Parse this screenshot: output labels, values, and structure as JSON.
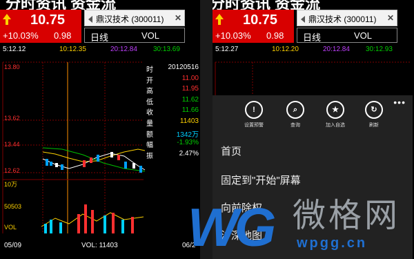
{
  "left": {
    "top_fragment": "分时资讯 资金流",
    "price": "10.75",
    "pct": "+10.03%",
    "chg": "0.98",
    "stock_name": "鼎汉技术 (300011)",
    "period": "日线",
    "indicator": "VOL",
    "ma5": "5:12.12",
    "ma10": "10:12.35",
    "ma20": "20:12.84",
    "ma30": "30:13.69",
    "price_ticks": [
      "13.80",
      "13.62",
      "13.44",
      "12.62"
    ],
    "info": [
      {
        "k": "时",
        "v": "20120516"
      },
      {
        "k": "开",
        "v": "11.00"
      },
      {
        "k": "高",
        "v": "11.95"
      },
      {
        "k": "低",
        "v": "11.62"
      },
      {
        "k": "收",
        "v": "11.66"
      },
      {
        "k": "量",
        "v": "11403"
      },
      {
        "k": "额",
        "v": "1342万"
      },
      {
        "k": "幅",
        "v": "-1.93%"
      },
      {
        "k": "振",
        "v": "2.47%"
      }
    ],
    "vol_ticks": [
      "10万",
      "50503",
      "VOL"
    ],
    "date_start": "05/09",
    "vol_label": "VOL: 11403",
    "date_end": "06/2"
  },
  "right": {
    "top_fragment": "分时资讯 资金流",
    "price": "10.75",
    "pct": "+10.03%",
    "chg": "0.98",
    "stock_name": "鼎汉技术 (300011)",
    "period": "日线",
    "indicator": "VOL",
    "ma5": "5:12.27",
    "ma10": "10:12.20",
    "ma20": "20:12.84",
    "ma30": "30:12.93",
    "menu_buttons": [
      {
        "icon": "!",
        "name": "alert",
        "label": "设置预警"
      },
      {
        "icon": "⌕",
        "name": "search",
        "label": "查询"
      },
      {
        "icon": "★",
        "name": "star",
        "label": "加入自选"
      },
      {
        "icon": "↻",
        "name": "refresh",
        "label": "刷新"
      }
    ],
    "more": "•••",
    "menu_items": [
      "首页",
      "固定到\"开始\"屏幕",
      "向前除权",
      "沪深地图"
    ]
  },
  "watermark": {
    "logo": "WG",
    "cn": "微格网",
    "url": "wpgg.cn"
  },
  "colors": {
    "red": "#d80000",
    "green": "#00c000",
    "yellow": "#ffd200",
    "blue": "#1f6fd1"
  },
  "chart_data": {
    "type": "candlestick",
    "title": "鼎汉技术 (300011) 日线",
    "volume_indicator": "VOL"
  }
}
